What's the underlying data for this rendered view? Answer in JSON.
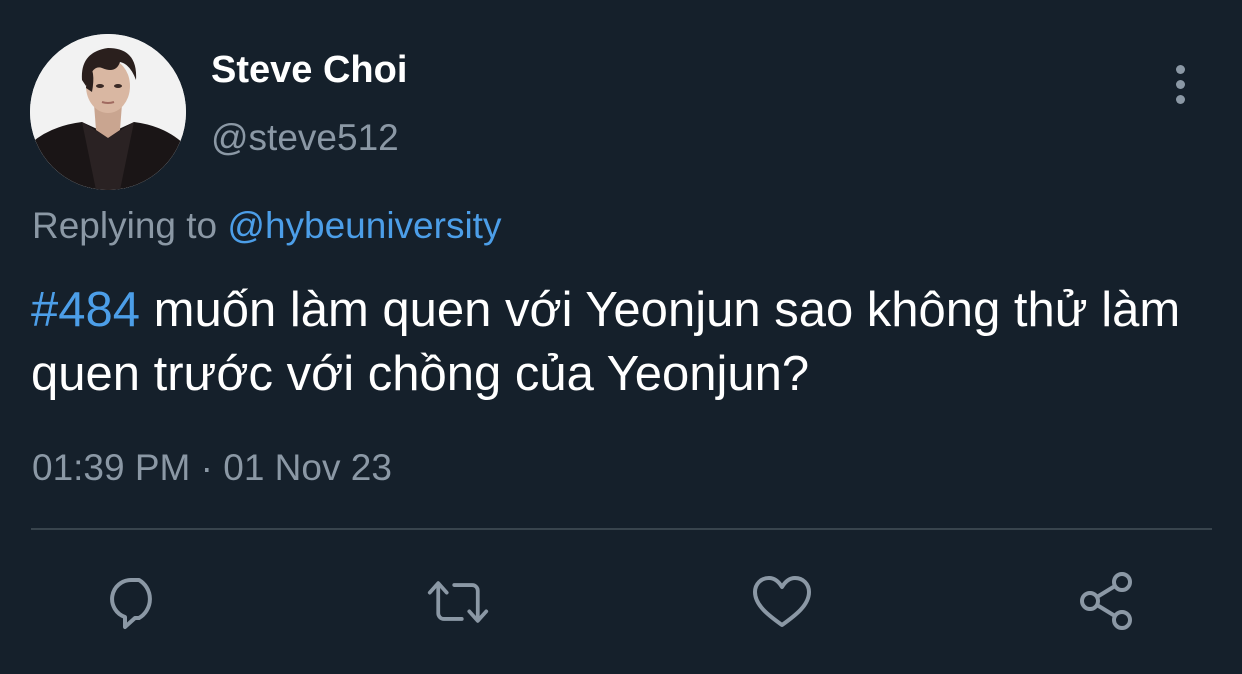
{
  "user": {
    "display_name": "Steve Choi",
    "handle": "@steve512"
  },
  "reply": {
    "prefix": "Replying to ",
    "target": "@hybeuniversity"
  },
  "tweet": {
    "hashtag": "#484",
    "text": " muốn làm quen với Yeonjun sao không thử làm quen trước với chồng của Yeonjun?"
  },
  "timestamp": "01:39 PM · 01 Nov 23",
  "actions": [
    {
      "icon": "reply-icon"
    },
    {
      "icon": "retweet-icon"
    },
    {
      "icon": "like-icon"
    },
    {
      "icon": "share-icon"
    }
  ],
  "more_icon": "more-options-icon",
  "colors": {
    "background": "#15202b",
    "text": "#ffffff",
    "secondary": "#8b98a5",
    "link": "#4c9ee8",
    "divider": "#38444d"
  }
}
